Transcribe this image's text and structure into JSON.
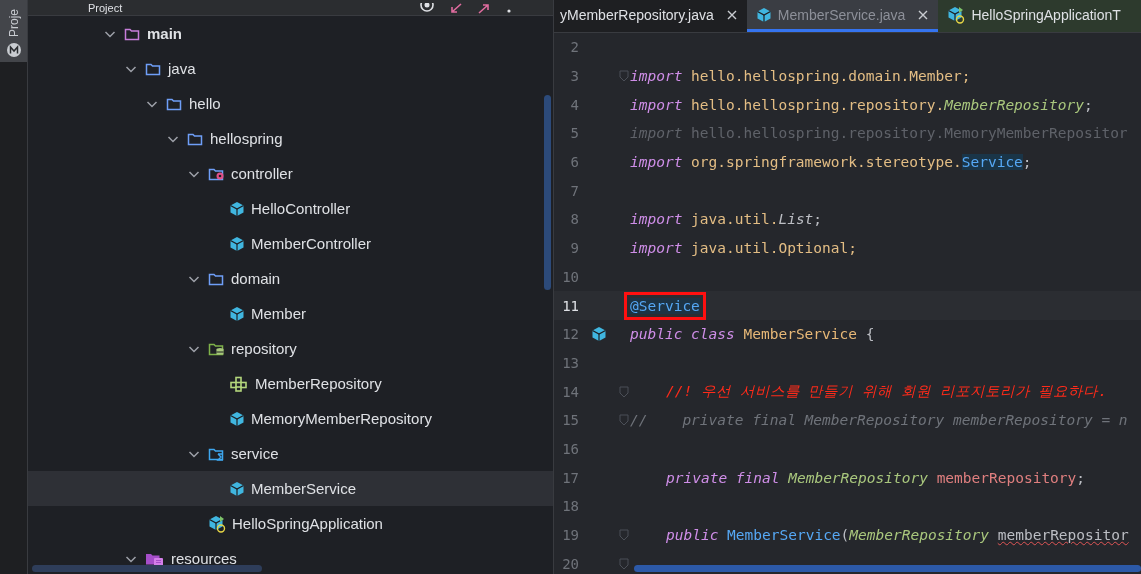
{
  "side_strip": {
    "label": "Proje"
  },
  "project_panel": {
    "title": "Project",
    "tree": [
      {
        "label": "main",
        "kind": "source-folder",
        "expanded": true,
        "selected": false,
        "children": [
          {
            "label": "java",
            "kind": "folder",
            "expanded": true,
            "selected": false,
            "children": [
              {
                "label": "hello",
                "kind": "folder",
                "expanded": true,
                "selected": false,
                "children": [
                  {
                    "label": "hellospring",
                    "kind": "folder",
                    "expanded": true,
                    "selected": false,
                    "children": [
                      {
                        "label": "controller",
                        "kind": "controller-folder",
                        "expanded": true,
                        "selected": false,
                        "children": [
                          {
                            "label": "HelloController",
                            "kind": "class",
                            "selected": false
                          },
                          {
                            "label": "MemberController",
                            "kind": "class",
                            "selected": false
                          }
                        ]
                      },
                      {
                        "label": "domain",
                        "kind": "folder",
                        "expanded": true,
                        "selected": false,
                        "children": [
                          {
                            "label": "Member",
                            "kind": "class",
                            "selected": false
                          }
                        ]
                      },
                      {
                        "label": "repository",
                        "kind": "repository-folder",
                        "expanded": true,
                        "selected": false,
                        "children": [
                          {
                            "label": "MemberRepository",
                            "kind": "interface",
                            "selected": false
                          },
                          {
                            "label": "MemoryMemberRepository",
                            "kind": "class",
                            "selected": false
                          }
                        ]
                      },
                      {
                        "label": "service",
                        "kind": "service-folder",
                        "expanded": true,
                        "selected": false,
                        "children": [
                          {
                            "label": "MemberService",
                            "kind": "class",
                            "selected": true
                          }
                        ]
                      },
                      {
                        "label": "HelloSpringApplication",
                        "kind": "app",
                        "selected": false
                      }
                    ]
                  }
                ]
              }
            ]
          },
          {
            "label": "resources",
            "kind": "resources-folder",
            "expanded": true,
            "selected": false
          }
        ]
      }
    ]
  },
  "editor": {
    "tabs": [
      {
        "label": "yMemberRepository.java",
        "kind": "none",
        "selected": false,
        "closable": true
      },
      {
        "label": "MemberService.java",
        "kind": "class",
        "selected": true,
        "closable": true
      },
      {
        "label": "HelloSpringApplicationT",
        "kind": "app",
        "selected": false,
        "closable": false
      }
    ],
    "lines": [
      {
        "number": "2"
      },
      {
        "number": "3",
        "fold": true,
        "tokens": [
          {
            "t": "import ",
            "kind": "kw"
          },
          {
            "t": "hello.hellospring.domain.Member;",
            "kind": "pkg"
          }
        ]
      },
      {
        "number": "4",
        "tokens": [
          {
            "t": "import ",
            "kind": "kw"
          },
          {
            "t": "hello.hellospring.repository.",
            "kind": "pkg"
          },
          {
            "t": "MemberRepository",
            "kind": "type"
          },
          {
            "t": ";",
            "kind": "plain"
          }
        ]
      },
      {
        "number": "5",
        "tokens": [
          {
            "t": "import ",
            "kind": "dimkw"
          },
          {
            "t": "hello.hellospring.repository.MemoryMemberRepositor",
            "kind": "dim"
          }
        ]
      },
      {
        "number": "6",
        "tokens": [
          {
            "t": "import ",
            "kind": "kw"
          },
          {
            "t": "org.springframework.stereotype.",
            "kind": "pkg"
          },
          {
            "t": "Service",
            "kind": "ref"
          },
          {
            "t": ";",
            "kind": "plain"
          }
        ]
      },
      {
        "number": "7"
      },
      {
        "number": "8",
        "tokens": [
          {
            "t": "import ",
            "kind": "kw"
          },
          {
            "t": "java.util.",
            "kind": "pkg"
          },
          {
            "t": "List",
            "kind": "iface"
          },
          {
            "t": ";",
            "kind": "plain"
          }
        ]
      },
      {
        "number": "9",
        "tokens": [
          {
            "t": "import ",
            "kind": "kw"
          },
          {
            "t": "java.util.Optional;",
            "kind": "pkg"
          }
        ]
      },
      {
        "number": "10"
      },
      {
        "number": "11",
        "current": true,
        "boxed": true,
        "tokens": [
          {
            "t": "@Service",
            "kind": "annotation"
          }
        ]
      },
      {
        "number": "12",
        "gutter_icon": true,
        "tokens": [
          {
            "t": "public class ",
            "kind": "kw"
          },
          {
            "t": "MemberService",
            "kind": "cls"
          },
          {
            "t": " {",
            "kind": "plain"
          }
        ]
      },
      {
        "number": "13"
      },
      {
        "number": "14",
        "fold": true,
        "indented": true,
        "tokens": [
          {
            "t": "//! 우선 서비스를 만들기 위해 회원 리포지토리가 필요하다.",
            "kind": "alert"
          }
        ]
      },
      {
        "number": "15",
        "fold": true,
        "tokens": [
          {
            "t": "//    private final MemberRepository memberRepository = n",
            "kind": "comment"
          }
        ]
      },
      {
        "number": "16"
      },
      {
        "number": "17",
        "indented": true,
        "tokens": [
          {
            "t": "private final ",
            "kind": "kw"
          },
          {
            "t": "MemberRepository ",
            "kind": "type"
          },
          {
            "t": "memberRepository",
            "kind": "field"
          },
          {
            "t": ";",
            "kind": "plain"
          }
        ]
      },
      {
        "number": "18"
      },
      {
        "number": "19",
        "fold": true,
        "indented": true,
        "tokens": [
          {
            "t": "public ",
            "kind": "kw"
          },
          {
            "t": "MemberService",
            "kind": "method"
          },
          {
            "t": "(",
            "kind": "plain"
          },
          {
            "t": "MemberRepository ",
            "kind": "type"
          },
          {
            "t": "memberRepositor",
            "kind": "error"
          }
        ]
      },
      {
        "number": "20",
        "fold": true
      }
    ]
  }
}
